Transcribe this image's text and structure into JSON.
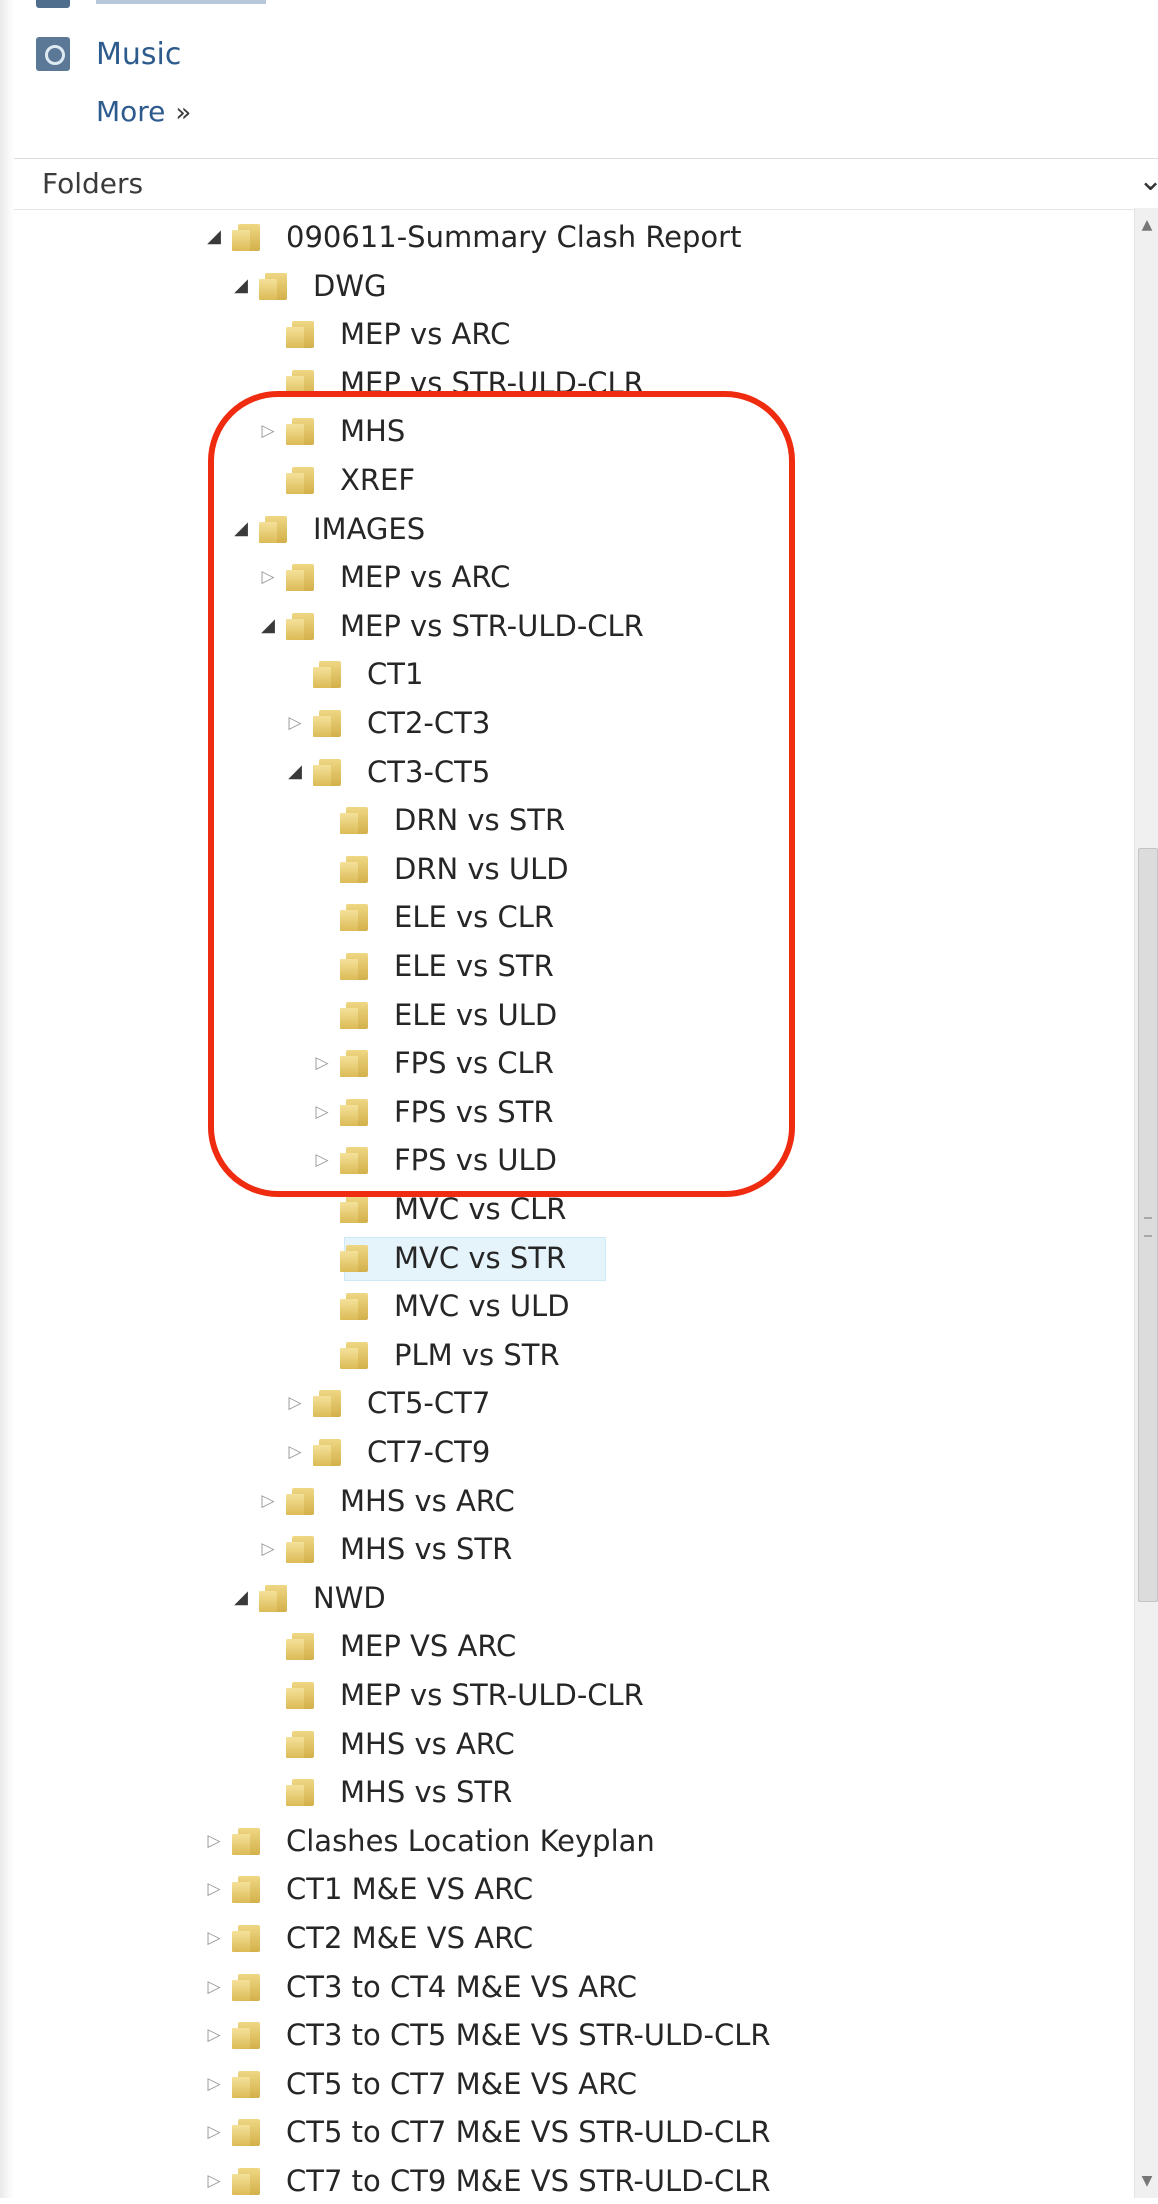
{
  "favorites": {
    "items": [
      {
        "label": "Music",
        "icon": "music-library-icon"
      }
    ],
    "more_label": "More",
    "more_icon": "double-chevron-right-icon"
  },
  "folders_pane": {
    "header": "Folders",
    "header_icon": "chevron-down-icon"
  },
  "tree": [
    {
      "label": "090611-Summary Clash Report",
      "level": 0,
      "state": "expanded"
    },
    {
      "label": "DWG",
      "level": 1,
      "state": "expanded"
    },
    {
      "label": "MEP vs ARC",
      "level": 2,
      "state": "none"
    },
    {
      "label": "MEP vs STR-ULD-CLR",
      "level": 2,
      "state": "none"
    },
    {
      "label": "MHS",
      "level": 2,
      "state": "collapsed"
    },
    {
      "label": "XREF",
      "level": 2,
      "state": "none"
    },
    {
      "label": "IMAGES",
      "level": 1,
      "state": "expanded"
    },
    {
      "label": "MEP vs ARC",
      "level": 2,
      "state": "collapsed"
    },
    {
      "label": "MEP vs STR-ULD-CLR",
      "level": 2,
      "state": "expanded"
    },
    {
      "label": "CT1",
      "level": 3,
      "state": "none"
    },
    {
      "label": "CT2-CT3",
      "level": 3,
      "state": "collapsed"
    },
    {
      "label": "CT3-CT5",
      "level": 3,
      "state": "expanded"
    },
    {
      "label": "DRN vs STR",
      "level": 4,
      "state": "none"
    },
    {
      "label": "DRN vs ULD",
      "level": 4,
      "state": "none"
    },
    {
      "label": "ELE vs CLR",
      "level": 4,
      "state": "none"
    },
    {
      "label": "ELE vs STR",
      "level": 4,
      "state": "none"
    },
    {
      "label": "ELE vs ULD",
      "level": 4,
      "state": "none"
    },
    {
      "label": "FPS vs CLR",
      "level": 4,
      "state": "collapsed"
    },
    {
      "label": "FPS vs STR",
      "level": 4,
      "state": "collapsed"
    },
    {
      "label": "FPS vs ULD",
      "level": 4,
      "state": "collapsed"
    },
    {
      "label": "MVC vs CLR",
      "level": 4,
      "state": "none"
    },
    {
      "label": "MVC vs STR",
      "level": 4,
      "state": "none",
      "selected": true
    },
    {
      "label": "MVC vs ULD",
      "level": 4,
      "state": "none"
    },
    {
      "label": "PLM vs STR",
      "level": 4,
      "state": "none"
    },
    {
      "label": "CT5-CT7",
      "level": 3,
      "state": "collapsed"
    },
    {
      "label": "CT7-CT9",
      "level": 3,
      "state": "collapsed"
    },
    {
      "label": "MHS vs ARC",
      "level": 2,
      "state": "collapsed"
    },
    {
      "label": "MHS vs STR",
      "level": 2,
      "state": "collapsed"
    },
    {
      "label": "NWD",
      "level": 1,
      "state": "expanded"
    },
    {
      "label": "MEP VS ARC",
      "level": 2,
      "state": "none"
    },
    {
      "label": "MEP vs STR-ULD-CLR",
      "level": 2,
      "state": "none"
    },
    {
      "label": "MHS vs ARC",
      "level": 2,
      "state": "none"
    },
    {
      "label": "MHS vs STR",
      "level": 2,
      "state": "none"
    },
    {
      "label": "Clashes Location Keyplan",
      "level": 0,
      "state": "collapsed"
    },
    {
      "label": "CT1 M&E VS ARC",
      "level": 0,
      "state": "collapsed"
    },
    {
      "label": "CT2 M&E VS ARC",
      "level": 0,
      "state": "collapsed"
    },
    {
      "label": "CT3 to CT4 M&E VS ARC",
      "level": 0,
      "state": "collapsed"
    },
    {
      "label": "CT3 to CT5 M&E VS STR-ULD-CLR",
      "level": 0,
      "state": "collapsed"
    },
    {
      "label": "CT5 to CT7 M&E VS ARC",
      "level": 0,
      "state": "collapsed"
    },
    {
      "label": "CT5 to CT7 M&E VS STR-ULD-CLR",
      "level": 0,
      "state": "collapsed"
    },
    {
      "label": "CT7 to CT9 M&E VS STR-ULD-CLR",
      "level": 0,
      "state": "collapsed"
    }
  ],
  "colors": {
    "link": "#2d5b8e",
    "folder": "#e2c25f",
    "selection": "#e5f3fb",
    "annotation": "#ef2b10"
  }
}
